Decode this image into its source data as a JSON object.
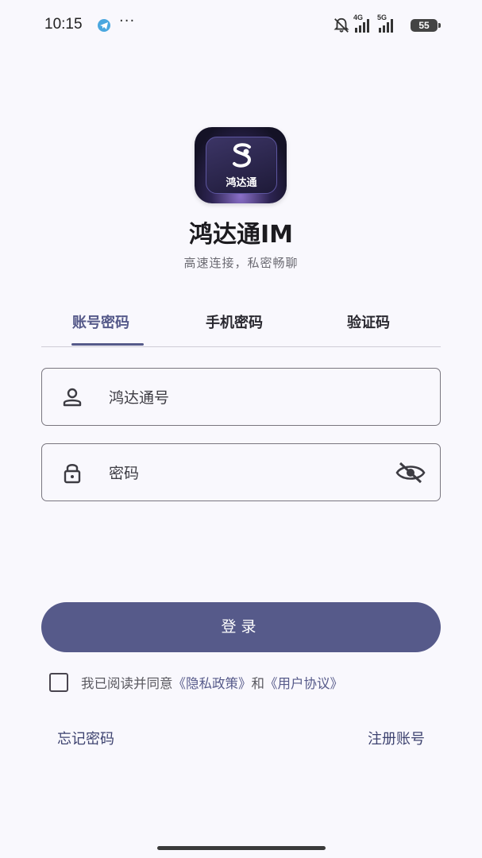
{
  "status_bar": {
    "time": "10:15",
    "dots": "···",
    "icons": [
      "telegram-icon",
      "bell-off-icon",
      "signal-icon",
      "signal-icon",
      "battery-icon"
    ],
    "net1": "4G",
    "net2": "5G",
    "battery": "55"
  },
  "app": {
    "logo_text": "鸿达通",
    "title": "鸿达通IM",
    "subtitle": "高速连接，私密畅聊"
  },
  "tabs": [
    {
      "label": "账号密码",
      "active": true
    },
    {
      "label": "手机密码",
      "active": false
    },
    {
      "label": "验证码",
      "active": false
    }
  ],
  "form": {
    "account_placeholder": "鸿达通号",
    "password_placeholder": "密码",
    "account_icon": "person-icon",
    "password_icon": "lock-icon",
    "visibility_icon": "eye-off-icon"
  },
  "login_label": "登录",
  "agreement": {
    "prefix": "我已阅读并同意",
    "privacy": "《隐私政策》",
    "and": "和",
    "terms": "《用户协议》",
    "checked": false
  },
  "footer": {
    "forgot": "忘记密码",
    "register": "注册账号"
  },
  "colors": {
    "accent": "#565a8a",
    "background": "#f9f8fd"
  }
}
